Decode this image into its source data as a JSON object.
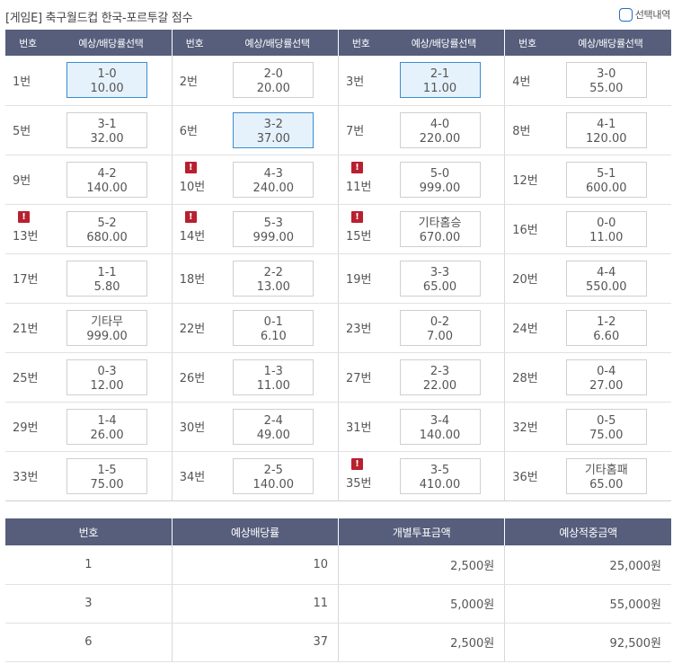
{
  "header": {
    "title": "[게임E] 축구월드컵 한국-포르투갈 점수",
    "selection_label": "선택내역"
  },
  "grid": {
    "col_num": "번호",
    "col_odds": "예상/배당률선택",
    "rows": [
      [
        {
          "num": "1번",
          "score": "1-0",
          "odds": "10.00",
          "selected": true,
          "warn": false
        },
        {
          "num": "2번",
          "score": "2-0",
          "odds": "20.00",
          "selected": false,
          "warn": false
        },
        {
          "num": "3번",
          "score": "2-1",
          "odds": "11.00",
          "selected": true,
          "warn": false
        },
        {
          "num": "4번",
          "score": "3-0",
          "odds": "55.00",
          "selected": false,
          "warn": false
        }
      ],
      [
        {
          "num": "5번",
          "score": "3-1",
          "odds": "32.00",
          "selected": false,
          "warn": false
        },
        {
          "num": "6번",
          "score": "3-2",
          "odds": "37.00",
          "selected": true,
          "warn": false
        },
        {
          "num": "7번",
          "score": "4-0",
          "odds": "220.00",
          "selected": false,
          "warn": false
        },
        {
          "num": "8번",
          "score": "4-1",
          "odds": "120.00",
          "selected": false,
          "warn": false
        }
      ],
      [
        {
          "num": "9번",
          "score": "4-2",
          "odds": "140.00",
          "selected": false,
          "warn": false
        },
        {
          "num": "10번",
          "score": "4-3",
          "odds": "240.00",
          "selected": false,
          "warn": true
        },
        {
          "num": "11번",
          "score": "5-0",
          "odds": "999.00",
          "selected": false,
          "warn": true
        },
        {
          "num": "12번",
          "score": "5-1",
          "odds": "600.00",
          "selected": false,
          "warn": false
        }
      ],
      [
        {
          "num": "13번",
          "score": "5-2",
          "odds": "680.00",
          "selected": false,
          "warn": true
        },
        {
          "num": "14번",
          "score": "5-3",
          "odds": "999.00",
          "selected": false,
          "warn": true
        },
        {
          "num": "15번",
          "score": "기타홈승",
          "odds": "670.00",
          "selected": false,
          "warn": true
        },
        {
          "num": "16번",
          "score": "0-0",
          "odds": "11.00",
          "selected": false,
          "warn": false
        }
      ],
      [
        {
          "num": "17번",
          "score": "1-1",
          "odds": "5.80",
          "selected": false,
          "warn": false
        },
        {
          "num": "18번",
          "score": "2-2",
          "odds": "13.00",
          "selected": false,
          "warn": false
        },
        {
          "num": "19번",
          "score": "3-3",
          "odds": "65.00",
          "selected": false,
          "warn": false
        },
        {
          "num": "20번",
          "score": "4-4",
          "odds": "550.00",
          "selected": false,
          "warn": false
        }
      ],
      [
        {
          "num": "21번",
          "score": "기타무",
          "odds": "999.00",
          "selected": false,
          "warn": false
        },
        {
          "num": "22번",
          "score": "0-1",
          "odds": "6.10",
          "selected": false,
          "warn": false
        },
        {
          "num": "23번",
          "score": "0-2",
          "odds": "7.00",
          "selected": false,
          "warn": false
        },
        {
          "num": "24번",
          "score": "1-2",
          "odds": "6.60",
          "selected": false,
          "warn": false
        }
      ],
      [
        {
          "num": "25번",
          "score": "0-3",
          "odds": "12.00",
          "selected": false,
          "warn": false
        },
        {
          "num": "26번",
          "score": "1-3",
          "odds": "11.00",
          "selected": false,
          "warn": false
        },
        {
          "num": "27번",
          "score": "2-3",
          "odds": "22.00",
          "selected": false,
          "warn": false
        },
        {
          "num": "28번",
          "score": "0-4",
          "odds": "27.00",
          "selected": false,
          "warn": false
        }
      ],
      [
        {
          "num": "29번",
          "score": "1-4",
          "odds": "26.00",
          "selected": false,
          "warn": false
        },
        {
          "num": "30번",
          "score": "2-4",
          "odds": "49.00",
          "selected": false,
          "warn": false
        },
        {
          "num": "31번",
          "score": "3-4",
          "odds": "140.00",
          "selected": false,
          "warn": false
        },
        {
          "num": "32번",
          "score": "0-5",
          "odds": "75.00",
          "selected": false,
          "warn": false
        }
      ],
      [
        {
          "num": "33번",
          "score": "1-5",
          "odds": "75.00",
          "selected": false,
          "warn": false
        },
        {
          "num": "34번",
          "score": "2-5",
          "odds": "140.00",
          "selected": false,
          "warn": false
        },
        {
          "num": "35번",
          "score": "3-5",
          "odds": "410.00",
          "selected": false,
          "warn": true
        },
        {
          "num": "36번",
          "score": "기타홈패",
          "odds": "65.00",
          "selected": false,
          "warn": false
        }
      ]
    ]
  },
  "summary": {
    "headers": [
      "번호",
      "예상배당률",
      "개별투표금액",
      "예상적중금액"
    ],
    "rows": [
      [
        "1",
        "10",
        "2,500원",
        "25,000원"
      ],
      [
        "3",
        "11",
        "5,000원",
        "55,000원"
      ],
      [
        "6",
        "37",
        "2,500원",
        "92,500원"
      ]
    ]
  },
  "colors": {
    "header_bg": "#565e7c",
    "selected_bg": "#e6f2fb",
    "selected_border": "#3a8ccf",
    "warn": "#b8202f",
    "checkbox_border": "#1d6fc4"
  },
  "icons": {
    "warn": "exclamation-icon",
    "checkbox": "checkbox-icon"
  }
}
